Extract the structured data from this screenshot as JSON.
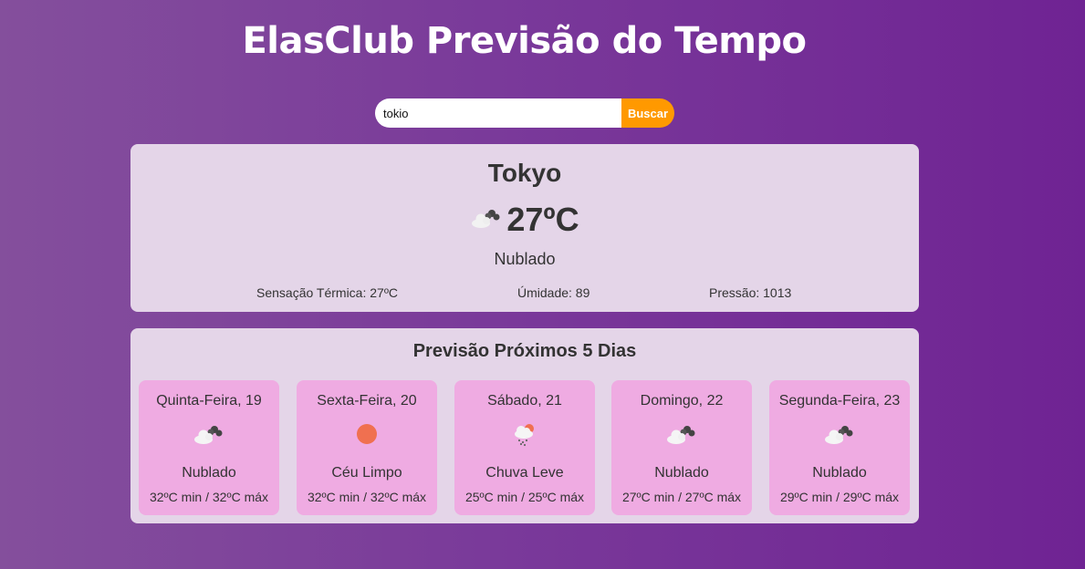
{
  "header": {
    "title": "ElasClub Previsão do Tempo"
  },
  "search": {
    "value": "tokio",
    "button_label": "Buscar"
  },
  "current": {
    "city": "Tokyo",
    "temperature": "27ºC",
    "icon": "cloud-icon",
    "description": "Nublado",
    "feels_like": "Sensação Térmica: 27ºC",
    "humidity": "Úmidade: 89",
    "pressure": "Pressão: 1013"
  },
  "forecast": {
    "title": "Previsão Próximos 5 Dias",
    "days": [
      {
        "name": "Quinta-Feira, 19",
        "icon": "cloud-icon",
        "description": "Nublado",
        "temps": "32ºC min / 32ºC máx"
      },
      {
        "name": "Sexta-Feira, 20",
        "icon": "sun-icon",
        "description": "Céu Limpo",
        "temps": "32ºC min / 32ºC máx"
      },
      {
        "name": "Sábado, 21",
        "icon": "rain-icon",
        "description": "Chuva Leve",
        "temps": "25ºC min / 25ºC máx"
      },
      {
        "name": "Domingo, 22",
        "icon": "cloud-icon",
        "description": "Nublado",
        "temps": "27ºC min / 27ºC máx"
      },
      {
        "name": "Segunda-Feira, 23",
        "icon": "cloud-icon",
        "description": "Nublado",
        "temps": "29ºC min / 29ºC máx"
      }
    ]
  },
  "colors": {
    "accent": "#ff9900",
    "card": "#e4d5e8",
    "day_card": "#efabe2",
    "sun": "#f07050"
  }
}
